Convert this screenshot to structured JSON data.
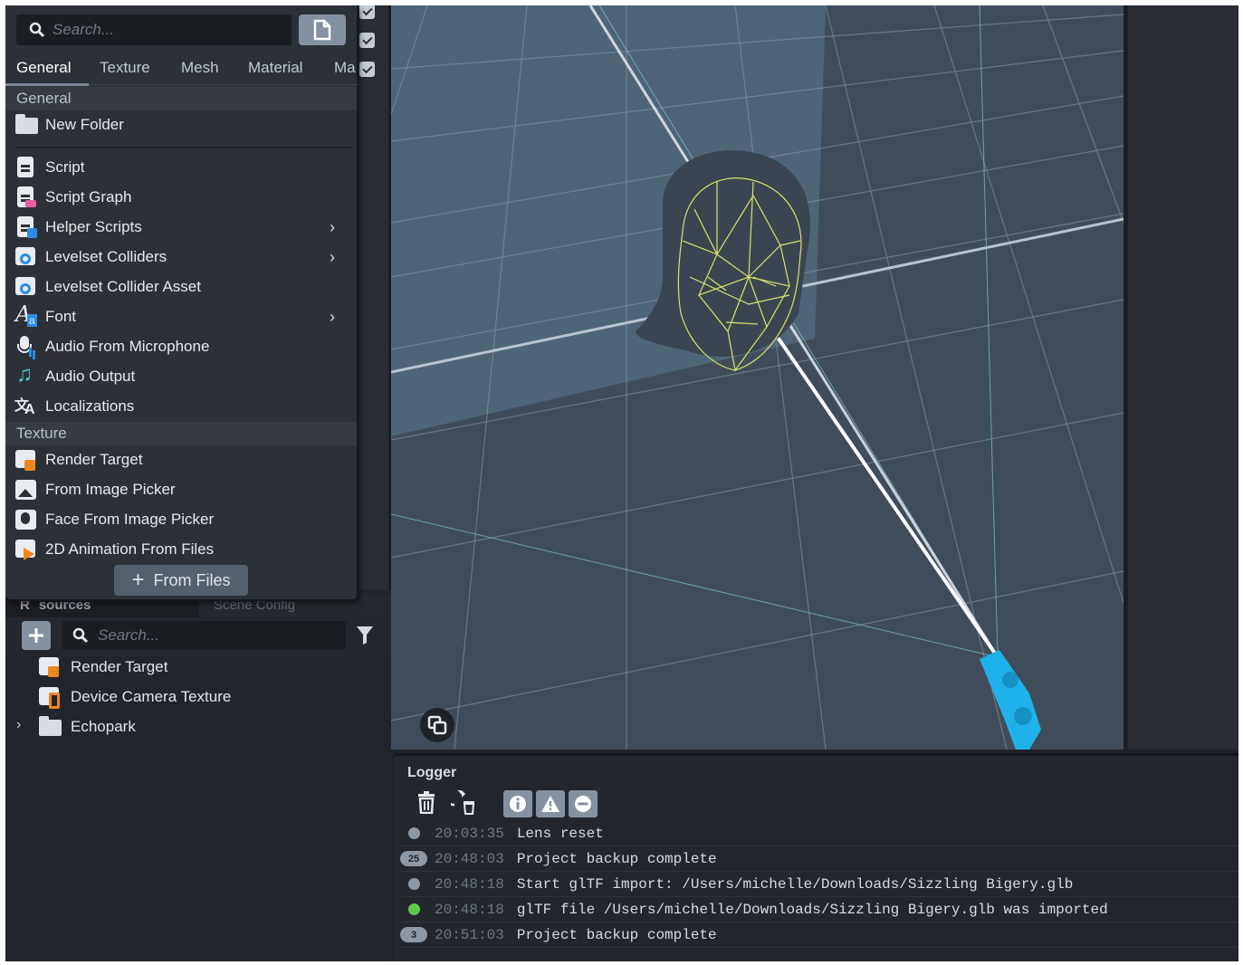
{
  "popup": {
    "search_placeholder": "Search...",
    "tabs": [
      "General",
      "Texture",
      "Mesh",
      "Material",
      "Ma"
    ],
    "sections": {
      "general": "General",
      "texture": "Texture"
    },
    "general_items": [
      {
        "label": "New Folder",
        "icon": "folder-icon"
      },
      {
        "label": "Script",
        "icon": "script-icon"
      },
      {
        "label": "Script Graph",
        "icon": "script-graph-icon"
      },
      {
        "label": "Helper Scripts",
        "icon": "helper-scripts-icon",
        "submenu": true
      },
      {
        "label": "Levelset Colliders",
        "icon": "levelset-collider-icon",
        "submenu": true
      },
      {
        "label": "Levelset Collider Asset",
        "icon": "levelset-collider-asset-icon"
      },
      {
        "label": "Font",
        "icon": "font-icon",
        "submenu": true
      },
      {
        "label": "Audio From Microphone",
        "icon": "microphone-icon"
      },
      {
        "label": "Audio Output",
        "icon": "music-note-icon"
      },
      {
        "label": "Localizations",
        "icon": "translate-icon"
      }
    ],
    "texture_items": [
      {
        "label": "Render Target",
        "icon": "render-target-icon"
      },
      {
        "label": "From Image Picker",
        "icon": "image-picker-icon"
      },
      {
        "label": "Face From Image Picker",
        "icon": "face-image-picker-icon"
      },
      {
        "label": "2D Animation From Files",
        "icon": "animation-icon"
      }
    ],
    "from_files_label": "From Files"
  },
  "resources": {
    "tabs": [
      "Resources",
      "Scene Config"
    ],
    "tab_visible": [
      "R",
      "sources"
    ],
    "search_placeholder": "Search...",
    "items": [
      {
        "label": "Render Target",
        "icon": "render-target-icon"
      },
      {
        "label": "Device Camera Texture",
        "icon": "device-camera-icon"
      },
      {
        "label": "Echopark",
        "icon": "folder-icon",
        "expandable": true
      }
    ]
  },
  "logger": {
    "title": "Logger",
    "entries": [
      {
        "badge": "",
        "time": "20:03:35",
        "message": "Lens reset",
        "status": "info"
      },
      {
        "badge": "25",
        "time": "20:48:03",
        "message": "Project backup complete",
        "status": "info"
      },
      {
        "badge": "",
        "time": "20:48:18",
        "message": "Start glTF import: /Users/michelle/Downloads/Sizzling Bigery.glb",
        "status": "info"
      },
      {
        "badge": "",
        "time": "20:48:18",
        "message": "glTF file /Users/michelle/Downloads/Sizzling Bigery.glb was imported",
        "status": "success"
      },
      {
        "badge": "3",
        "time": "20:51:03",
        "message": "Project backup complete",
        "status": "info"
      }
    ]
  },
  "colors": {
    "accent_button": "#8591a0",
    "success": "#5fc94a",
    "wireframe": "#d8e26a",
    "camera": "#1fb2ea"
  }
}
